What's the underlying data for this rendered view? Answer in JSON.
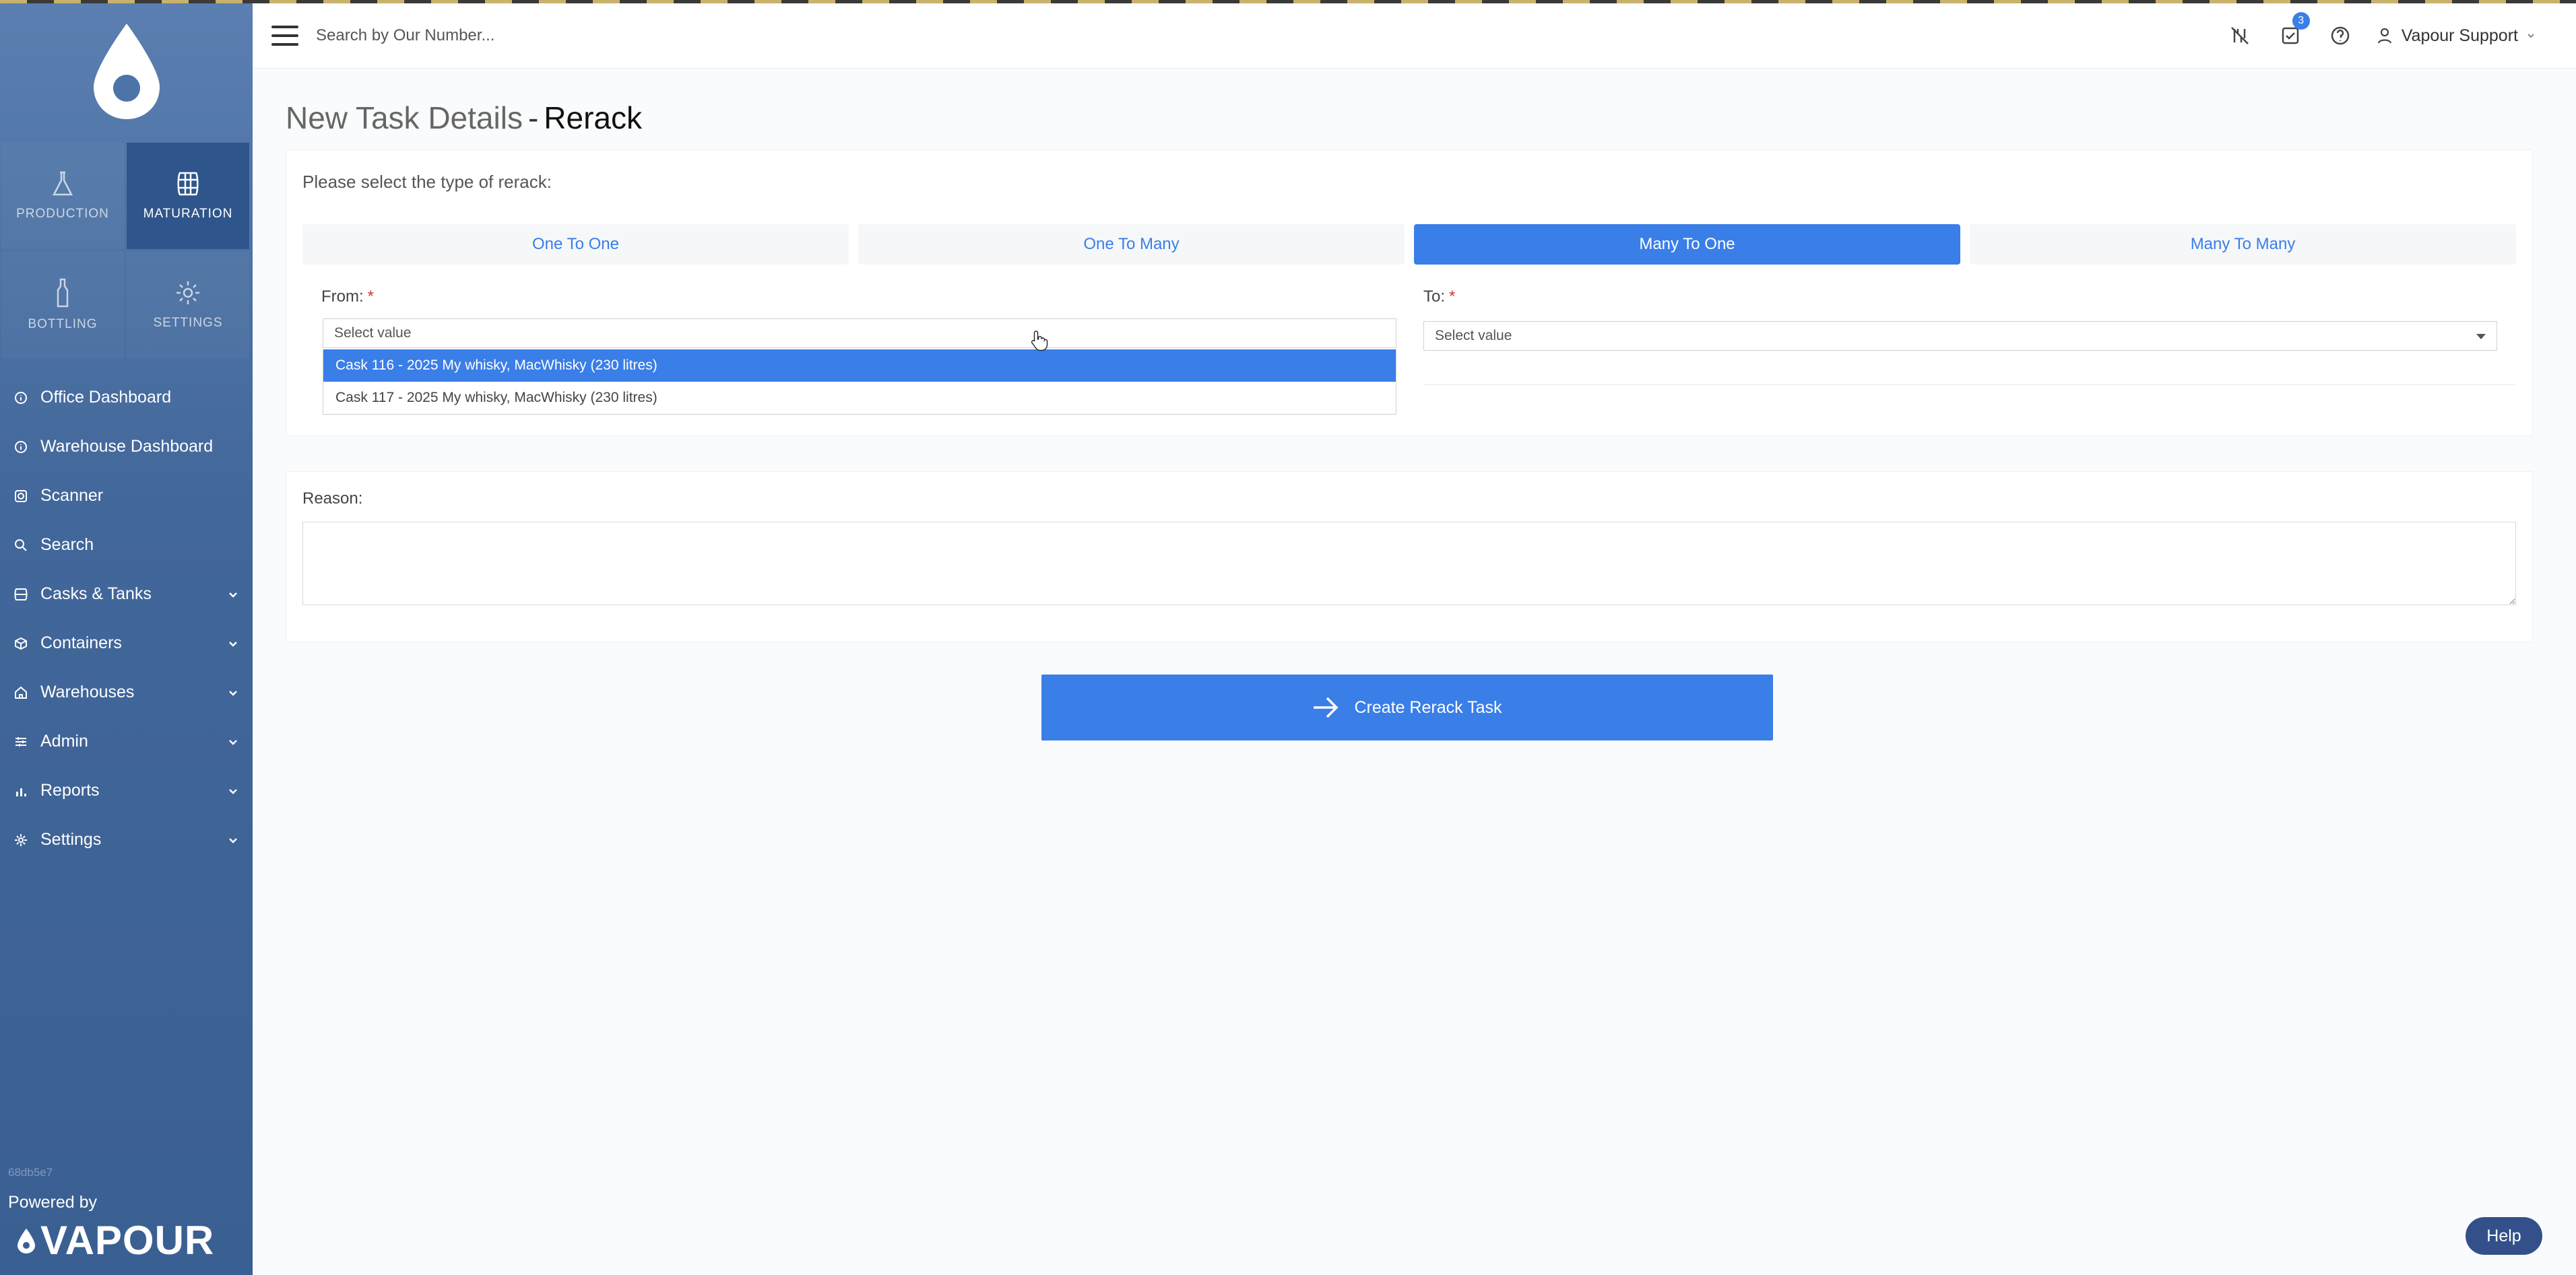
{
  "sidebar": {
    "modules": [
      {
        "label": "PRODUCTION",
        "icon": "flask-icon",
        "active": false
      },
      {
        "label": "MATURATION",
        "icon": "barrel-icon",
        "active": true
      },
      {
        "label": "BOTTLING",
        "icon": "bottle-icon",
        "active": false
      },
      {
        "label": "SETTINGS",
        "icon": "gear-icon",
        "active": false
      }
    ],
    "nav": [
      {
        "label": "Office Dashboard",
        "icon": "info-circle-icon"
      },
      {
        "label": "Warehouse Dashboard",
        "icon": "info-circle-icon"
      },
      {
        "label": "Scanner",
        "icon": "camera-icon"
      },
      {
        "label": "Search",
        "icon": "search-icon"
      },
      {
        "label": "Casks & Tanks",
        "icon": "barrel-icon",
        "expandable": true
      },
      {
        "label": "Containers",
        "icon": "cube-icon",
        "expandable": true
      },
      {
        "label": "Warehouses",
        "icon": "home-icon",
        "expandable": true
      },
      {
        "label": "Admin",
        "icon": "sliders-icon",
        "expandable": true
      },
      {
        "label": "Reports",
        "icon": "bar-chart-icon",
        "expandable": true
      },
      {
        "label": "Settings",
        "icon": "gear-icon",
        "expandable": true
      }
    ],
    "version": "68db5e7",
    "powered_by": "Powered by",
    "brand": "VAPOUR"
  },
  "topbar": {
    "search_placeholder": "Search by Our Number...",
    "tasks_badge": "3",
    "user_name": "Vapour Support"
  },
  "page": {
    "title_main": "New Task Details",
    "title_sep": "-",
    "title_sub": "Rerack"
  },
  "rerack": {
    "prompt": "Please select the type of rerack:",
    "types": [
      {
        "label": "One To One",
        "active": false
      },
      {
        "label": "One To Many",
        "active": false
      },
      {
        "label": "Many To One",
        "active": true
      },
      {
        "label": "Many To Many",
        "active": false
      }
    ],
    "from_label": "From:",
    "to_label": "To:",
    "required_mark": "*",
    "from_placeholder": "Select value",
    "to_placeholder": "Select value",
    "from_options": [
      "Cask 116 - 2025 My whisky, MacWhisky (230 litres)",
      "Cask 117 - 2025 My whisky, MacWhisky (230 litres)"
    ]
  },
  "reason": {
    "label": "Reason:",
    "value": ""
  },
  "actions": {
    "create_label": "Create Rerack Task",
    "help_label": "Help"
  },
  "colors": {
    "accent": "#3a7ee8",
    "sidebar": "#42679a",
    "help": "#33508a"
  }
}
